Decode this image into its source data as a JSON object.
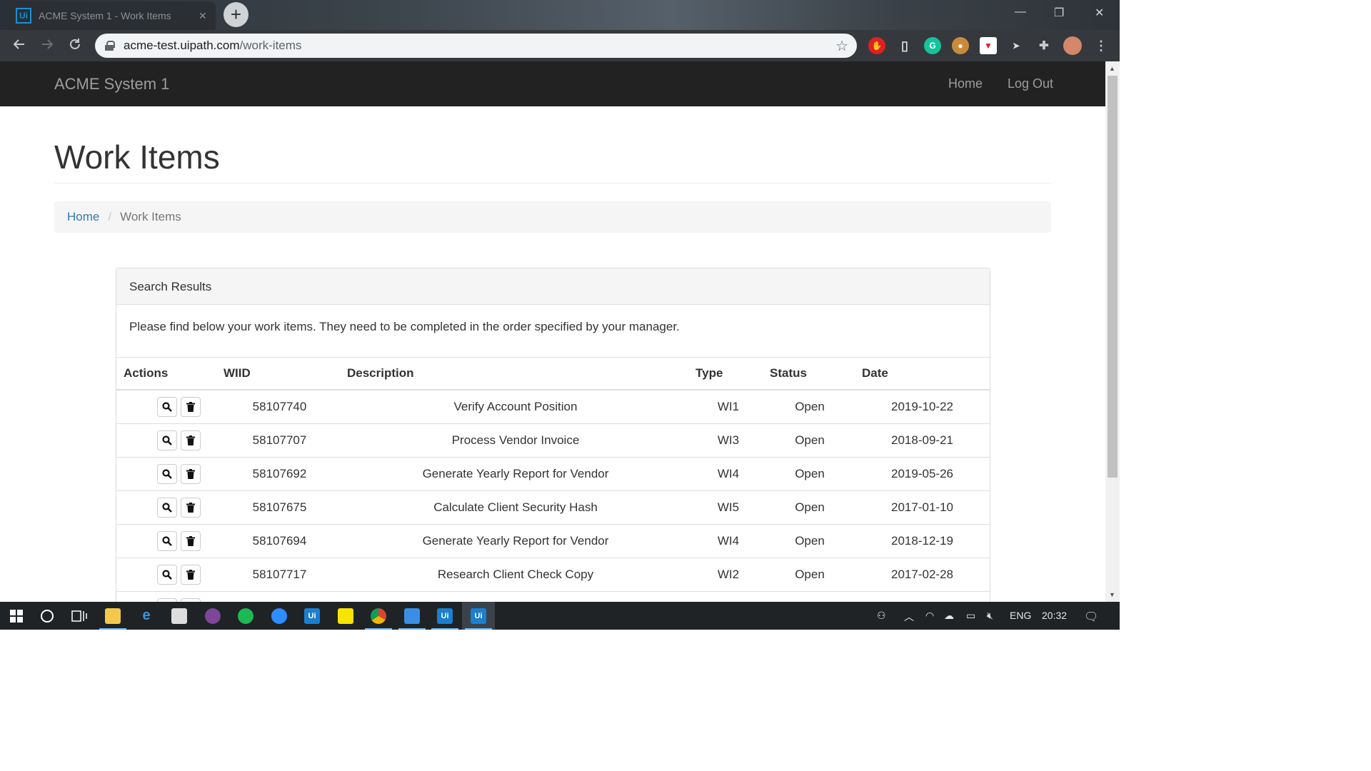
{
  "browser": {
    "tab_title": "ACME System 1 - Work Items",
    "favicon_text": "Ui",
    "tab_close": "✕",
    "new_tab": "+",
    "url_host": "acme-test.uipath.com",
    "url_path": "/work-items",
    "window_controls": {
      "minimize": "—",
      "restore": "❐",
      "close": "✕"
    }
  },
  "appnav": {
    "brand": "ACME System 1",
    "links": {
      "home": "Home",
      "logout": "Log Out"
    }
  },
  "page": {
    "title": "Work Items",
    "breadcrumb": {
      "home": "Home",
      "separator": "/",
      "current": "Work Items"
    }
  },
  "panel": {
    "heading": "Search Results",
    "body": "Please find below your work items. They need to be completed in the order specified by your manager."
  },
  "table": {
    "headers": {
      "actions": "Actions",
      "wiid": "WIID",
      "description": "Description",
      "type": "Type",
      "status": "Status",
      "date": "Date"
    },
    "rows": [
      {
        "wiid": "58107740",
        "description": "Verify Account Position",
        "type": "WI1",
        "status": "Open",
        "date": "2019-10-22"
      },
      {
        "wiid": "58107707",
        "description": "Process Vendor Invoice",
        "type": "WI3",
        "status": "Open",
        "date": "2018-09-21"
      },
      {
        "wiid": "58107692",
        "description": "Generate Yearly Report for Vendor",
        "type": "WI4",
        "status": "Open",
        "date": "2019-05-26"
      },
      {
        "wiid": "58107675",
        "description": "Calculate Client Security Hash",
        "type": "WI5",
        "status": "Open",
        "date": "2017-01-10"
      },
      {
        "wiid": "58107694",
        "description": "Generate Yearly Report for Vendor",
        "type": "WI4",
        "status": "Open",
        "date": "2018-12-19"
      },
      {
        "wiid": "58107717",
        "description": "Research Client Check Copy",
        "type": "WI2",
        "status": "Open",
        "date": "2017-02-28"
      }
    ]
  },
  "taskbar": {
    "language": "ENG",
    "time": "20:32",
    "uipath_label": "Ui"
  },
  "colors": {
    "link": "#337ab7",
    "navbar": "#222222",
    "nav_text": "#9d9d9d"
  }
}
